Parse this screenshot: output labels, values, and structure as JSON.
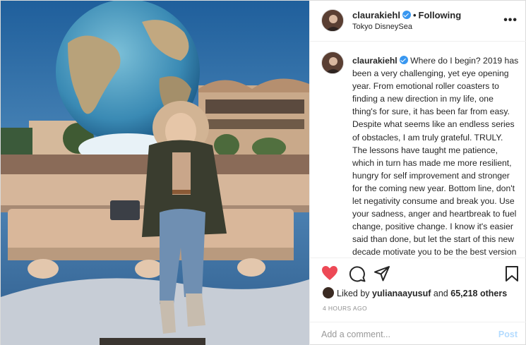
{
  "post": {
    "author": "claurakiehl",
    "follow_status": "Following",
    "separator": "•",
    "location": "Tokyo DisneySea",
    "more_icon": "more-horizontal-icon",
    "more_glyph": "•••"
  },
  "caption": {
    "username": "claurakiehl",
    "text": "Where do I begin? 2019 has been a very challenging, yet eye opening year. From emotional roller coasters to finding a new direction in my life, one thing's for sure, it has been far from easy. Despite what seems like an endless series of obstacles, I am truly grateful. TRULY. The lessons have taught me patience, which in turn has made me more resilient, hungry for self improvement and stronger for the coming new year. Bottom line, don't let negativity consume and break you. Use your sadness, anger and heartbreak to fuel change, positive change. I know it's easier said than done, but let the start of this new decade motivate you to be the best version of yourself. Create"
  },
  "actions": {
    "like_icon": "heart-filled-icon",
    "comment_icon": "comment-icon",
    "share_icon": "share-icon",
    "save_icon": "bookmark-icon",
    "like_color": "#ed4956"
  },
  "likes": {
    "prefix": "Liked by",
    "user": "yulianaayusuf",
    "conjunction": "and",
    "count": "65,218 others"
  },
  "timestamp": "4 HOURS AGO",
  "comment_box": {
    "placeholder": "Add a comment...",
    "post_label": "Post"
  },
  "colors": {
    "verified": "#3897f0",
    "post_disabled": "#b3dbff"
  }
}
